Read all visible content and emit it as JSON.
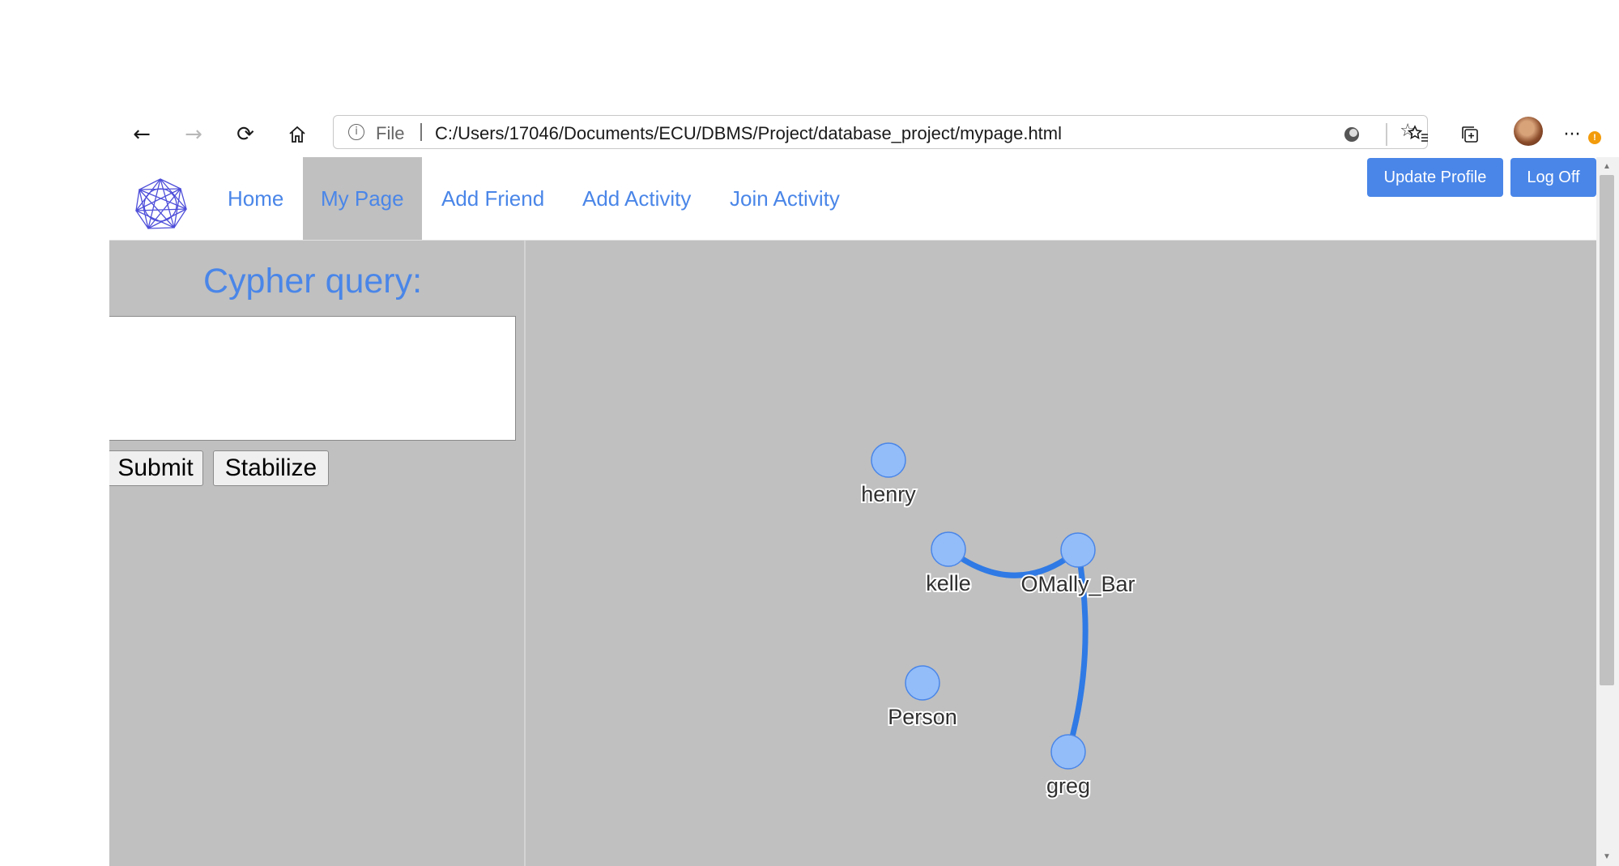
{
  "browser": {
    "file_label": "File",
    "url": "C:/Users/17046/Documents/ECU/DBMS/Project/database_project/mypage.html",
    "notification_count": "!"
  },
  "nav": {
    "items": [
      "Home",
      "My Page",
      "Add Friend",
      "Add Activity",
      "Join Activity"
    ],
    "active": "My Page",
    "update_profile": "Update Profile",
    "log_off": "Log Off"
  },
  "query": {
    "title": "Cypher query:",
    "value": "",
    "submit": "Submit",
    "stabilize": "Stabilize"
  },
  "graph": {
    "node_color": "#93bdf9",
    "node_border": "#4a86e8",
    "edge_color": "#2f7ae5",
    "nodes": [
      "henry",
      "kelle",
      "OMally_Bar",
      "Person",
      "greg"
    ],
    "edges": [
      [
        "kelle",
        "OMally_Bar"
      ],
      [
        "OMally_Bar",
        "greg"
      ]
    ]
  }
}
